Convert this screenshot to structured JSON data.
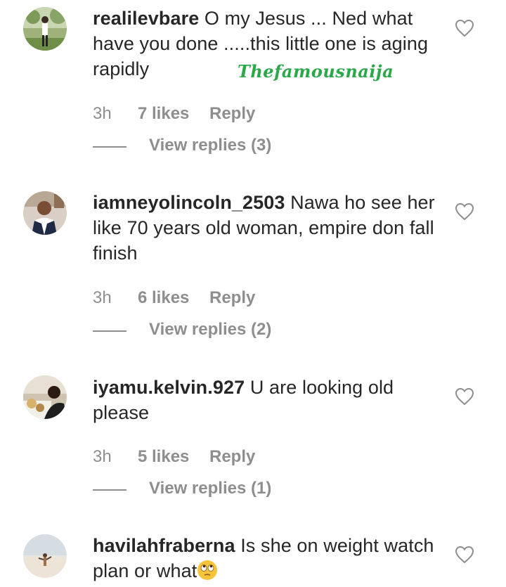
{
  "comments": [
    {
      "username": "realilevbare",
      "text": "O my Jesus ... Ned what have you done .....this little one is aging rapidly",
      "time": "3h",
      "likes": "7 likes",
      "reply": "Reply",
      "view_replies": "View replies (3)",
      "avatar_icon": "avatar-person-outdoors"
    },
    {
      "username": "iamneyolincoln_2503",
      "text": "Nawa ho see her like 70 years old woman, empire don fall finish",
      "time": "3h",
      "likes": "6 likes",
      "reply": "Reply",
      "view_replies": "View replies (2)",
      "avatar_icon": "avatar-man-suit"
    },
    {
      "username": "iyamu.kelvin.927",
      "text": "U are looking old please",
      "time": "3h",
      "likes": "5 likes",
      "reply": "Reply",
      "view_replies": "View replies (1)",
      "avatar_icon": "avatar-man-dining"
    },
    {
      "username": "havilahfraberna",
      "text": "Is she on weight watch plan or what",
      "emoji": "eye-roll-emoji",
      "avatar_icon": "avatar-beach"
    }
  ],
  "watermark": "Thefamousnaija",
  "colors": {
    "text": "#262626",
    "meta": "#8e8e8e",
    "watermark": "#2aa84a",
    "heart_outline": "#8e8e8e"
  }
}
